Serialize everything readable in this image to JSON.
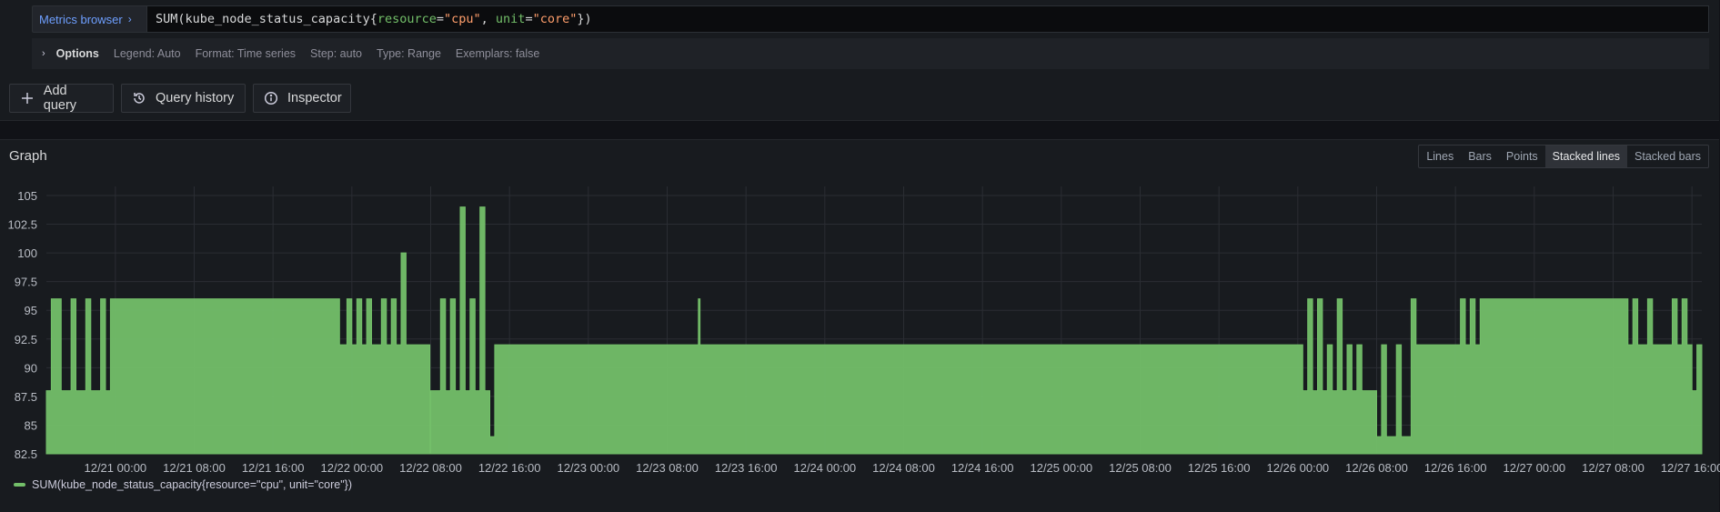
{
  "query_editor": {
    "metrics_browser_label": "Metrics browser",
    "query_parts": {
      "fn": "SUM(kube_node_status_capacity{",
      "k1": "resource",
      "eq1": "=",
      "v1": "\"cpu\"",
      "sep": ", ",
      "k2": "unit",
      "eq2": "=",
      "v2": "\"core\"",
      "end": "})"
    },
    "options": {
      "title": "Options",
      "items": [
        "Legend: Auto",
        "Format: Time series",
        "Step: auto",
        "Type: Range",
        "Exemplars: false"
      ]
    }
  },
  "toolbar": {
    "add_query_label": "Add query",
    "query_history_label": "Query history",
    "inspector_label": "Inspector"
  },
  "graph": {
    "title": "Graph",
    "display_modes": [
      "Lines",
      "Bars",
      "Points",
      "Stacked lines",
      "Stacked bars"
    ],
    "active_mode": "Stacked lines",
    "legend_label": "SUM(kube_node_status_capacity{resource=\"cpu\", unit=\"core\"})"
  },
  "colors": {
    "series": "#73bf69",
    "accent_link": "#6e9fff",
    "background": "#111217",
    "panel": "#181b1f"
  },
  "chart_data": {
    "type": "area",
    "series": [
      {
        "name": "SUM(kube_node_status_capacity{resource=\"cpu\", unit=\"core\"})",
        "stacked": true,
        "points": [
          [
            "12/20 17:00",
            88
          ],
          [
            "12/20 17:30",
            96
          ],
          [
            "12/20 18:30",
            88
          ],
          [
            "12/20 19:30",
            96
          ],
          [
            "12/20 20:00",
            88
          ],
          [
            "12/20 21:00",
            96
          ],
          [
            "12/20 21:30",
            88
          ],
          [
            "12/20 22:30",
            96
          ],
          [
            "12/20 23:00",
            88
          ],
          [
            "12/20 23:30",
            96
          ],
          [
            "12/21 22:30",
            96
          ],
          [
            "12/21 22:45",
            92
          ],
          [
            "12/21 23:30",
            96
          ],
          [
            "12/22 00:00",
            92
          ],
          [
            "12/22 00:30",
            96
          ],
          [
            "12/22 01:00",
            92
          ],
          [
            "12/22 01:30",
            96
          ],
          [
            "12/22 02:00",
            92
          ],
          [
            "12/22 03:00",
            96
          ],
          [
            "12/22 03:30",
            92
          ],
          [
            "12/22 04:00",
            96
          ],
          [
            "12/22 04:30",
            92
          ],
          [
            "12/22 05:00",
            100
          ],
          [
            "12/22 05:30",
            92
          ],
          [
            "12/22 07:50",
            92
          ],
          [
            "12/22 07:55",
            82.5
          ],
          [
            "12/22 08:00",
            88
          ],
          [
            "12/22 09:00",
            96
          ],
          [
            "12/22 09:30",
            88
          ],
          [
            "12/22 10:00",
            96
          ],
          [
            "12/22 10:30",
            88
          ],
          [
            "12/22 11:00",
            104
          ],
          [
            "12/22 11:30",
            88
          ],
          [
            "12/22 12:00",
            96
          ],
          [
            "12/22 12:30",
            88
          ],
          [
            "12/22 13:00",
            104
          ],
          [
            "12/22 13:30",
            88
          ],
          [
            "12/22 14:00",
            84
          ],
          [
            "12/22 14:30",
            92
          ],
          [
            "12/23 11:00",
            92
          ],
          [
            "12/23 11:10",
            96
          ],
          [
            "12/23 11:20",
            92
          ],
          [
            "12/26 00:00",
            92
          ],
          [
            "12/26 00:30",
            88
          ],
          [
            "12/26 01:00",
            96
          ],
          [
            "12/26 01:30",
            88
          ],
          [
            "12/26 02:00",
            96
          ],
          [
            "12/26 02:30",
            88
          ],
          [
            "12/26 03:00",
            92
          ],
          [
            "12/26 03:30",
            88
          ],
          [
            "12/26 04:00",
            96
          ],
          [
            "12/26 04:30",
            88
          ],
          [
            "12/26 05:00",
            92
          ],
          [
            "12/26 05:30",
            88
          ],
          [
            "12/26 06:00",
            92
          ],
          [
            "12/26 06:30",
            88
          ],
          [
            "12/26 08:00",
            84
          ],
          [
            "12/26 08:30",
            92
          ],
          [
            "12/26 09:00",
            84
          ],
          [
            "12/26 10:00",
            92
          ],
          [
            "12/26 10:30",
            84
          ],
          [
            "12/26 11:30",
            96
          ],
          [
            "12/26 12:00",
            92
          ],
          [
            "12/26 16:00",
            92
          ],
          [
            "12/26 16:30",
            96
          ],
          [
            "12/26 17:00",
            92
          ],
          [
            "12/26 17:30",
            96
          ],
          [
            "12/26 18:00",
            92
          ],
          [
            "12/26 18:30",
            96
          ],
          [
            "12/27 09:00",
            96
          ],
          [
            "12/27 09:30",
            92
          ],
          [
            "12/27 10:00",
            96
          ],
          [
            "12/27 10:30",
            92
          ],
          [
            "12/27 11:30",
            96
          ],
          [
            "12/27 12:00",
            92
          ],
          [
            "12/27 14:00",
            96
          ],
          [
            "12/27 14:30",
            92
          ],
          [
            "12/27 15:00",
            96
          ],
          [
            "12/27 15:30",
            92
          ],
          [
            "12/27 16:00",
            88
          ],
          [
            "12/27 16:30",
            92
          ],
          [
            "12/27 17:00",
            92
          ]
        ]
      }
    ],
    "x_tick_labels": [
      "12/21 00:00",
      "12/21 08:00",
      "12/21 16:00",
      "12/22 00:00",
      "12/22 08:00",
      "12/22 16:00",
      "12/23 00:00",
      "12/23 08:00",
      "12/23 16:00",
      "12/24 00:00",
      "12/24 08:00",
      "12/24 16:00",
      "12/25 00:00",
      "12/25 08:00",
      "12/25 16:00",
      "12/26 00:00",
      "12/26 08:00",
      "12/26 16:00",
      "12/27 00:00",
      "12/27 08:00",
      "12/27 16:00"
    ],
    "y_tick_labels": [
      "82.5",
      "85",
      "87.5",
      "90",
      "92.5",
      "95",
      "97.5",
      "100",
      "102.5",
      "105"
    ],
    "xlim": [
      "12/20 17:00",
      "12/27 17:00"
    ],
    "ylim": [
      82,
      106.5
    ],
    "grid": true,
    "legend_position": "bottom-left"
  }
}
